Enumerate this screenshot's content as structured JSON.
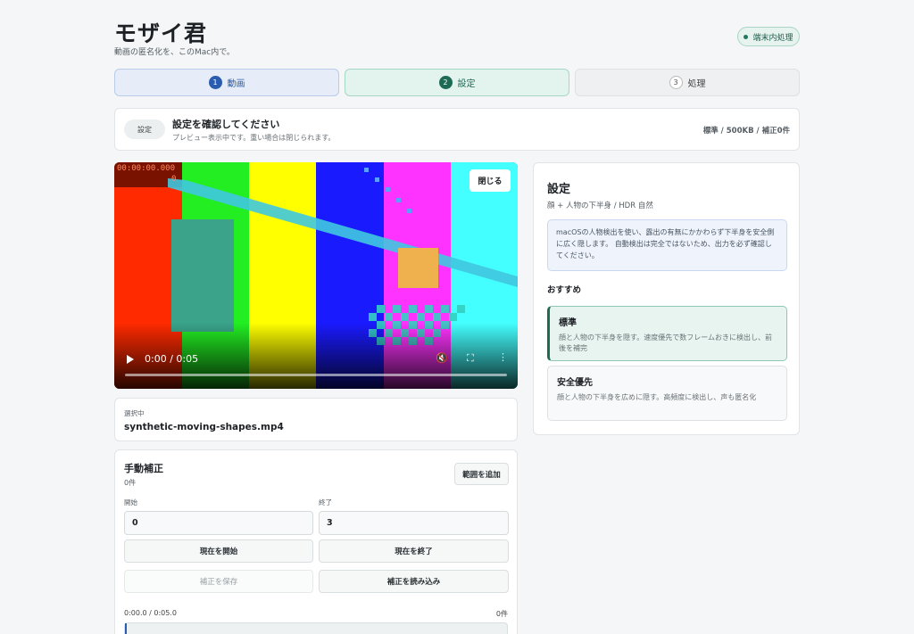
{
  "app": {
    "title": "モザイ君",
    "subtitle": "動画の匿名化を、このMac内で。",
    "badge": "端末内処理"
  },
  "steps": [
    {
      "num": "1",
      "label": "動画"
    },
    {
      "num": "2",
      "label": "設定"
    },
    {
      "num": "3",
      "label": "処理"
    }
  ],
  "status": {
    "pill": "設定",
    "title": "設定を確認してください",
    "subtitle": "プレビュー表示中です。重い場合は閉じられます。",
    "summary": "標準 / 500KB / 補正0件"
  },
  "video": {
    "close_label": "閉じる",
    "time": "0:00 / 0:05",
    "timecode": "00:00:00.000",
    "frame": "0",
    "progress": 0.0
  },
  "selected": {
    "label": "選択中",
    "filename": "synthetic-moving-shapes.mp4"
  },
  "manual": {
    "title": "手動補正",
    "count": "0件",
    "add_range": "範囲を追加",
    "start_label": "開始",
    "start_value": "0",
    "end_label": "終了",
    "end_value": "3",
    "set_start": "現在を開始",
    "set_end": "現在を終了",
    "save": "補正を保存",
    "load": "補正を読み込み",
    "timeline": "0:00.0 / 0:05.0",
    "timeline_count": "0件"
  },
  "settings": {
    "title": "設定",
    "subtitle": "顔 + 人物の下半身 / HDR 自然",
    "info": "macOSの人物検出を使い、露出の有無にかかわらず下半身を安全側に広く隠します。 自動検出は完全ではないため、出力を必ず確認してください。",
    "recommended": "おすすめ",
    "options": [
      {
        "title": "標準",
        "desc": "顔と人物の下半身を隠す。速度優先で数フレームおきに検出し、前後を補完",
        "selected": true
      },
      {
        "title": "安全優先",
        "desc": "顔と人物の下半身を広めに隠す。高頻度に検出し、声も匿名化",
        "selected": false
      }
    ]
  },
  "colors": {
    "accent_blue": "#2a5db0",
    "accent_green": "#1e6b55",
    "bars": [
      "#ff2a00",
      "#22ee22",
      "#ffff00",
      "#1a1aff",
      "#ff33ff",
      "#44ffff"
    ]
  }
}
